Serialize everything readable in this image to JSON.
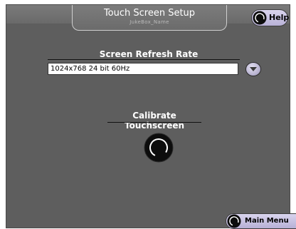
{
  "header": {
    "title": "Touch Screen Setup",
    "subtitle": "JukeBox_Name",
    "help_label": "Help"
  },
  "refresh": {
    "heading": "Screen Refresh Rate",
    "selected_value": "1024x768 24 bit 60Hz"
  },
  "calibrate": {
    "heading": "Calibrate Touchscreen"
  },
  "footer": {
    "main_menu_label": "Main Menu"
  },
  "colors": {
    "background": "#5e5e5e",
    "button_fill": "#c9c3e3",
    "knob": "#111111"
  },
  "icons": {
    "help": "knob-icon",
    "dropdown": "chevron-down-icon",
    "calibrate": "knob-icon",
    "main_menu": "knob-icon"
  }
}
